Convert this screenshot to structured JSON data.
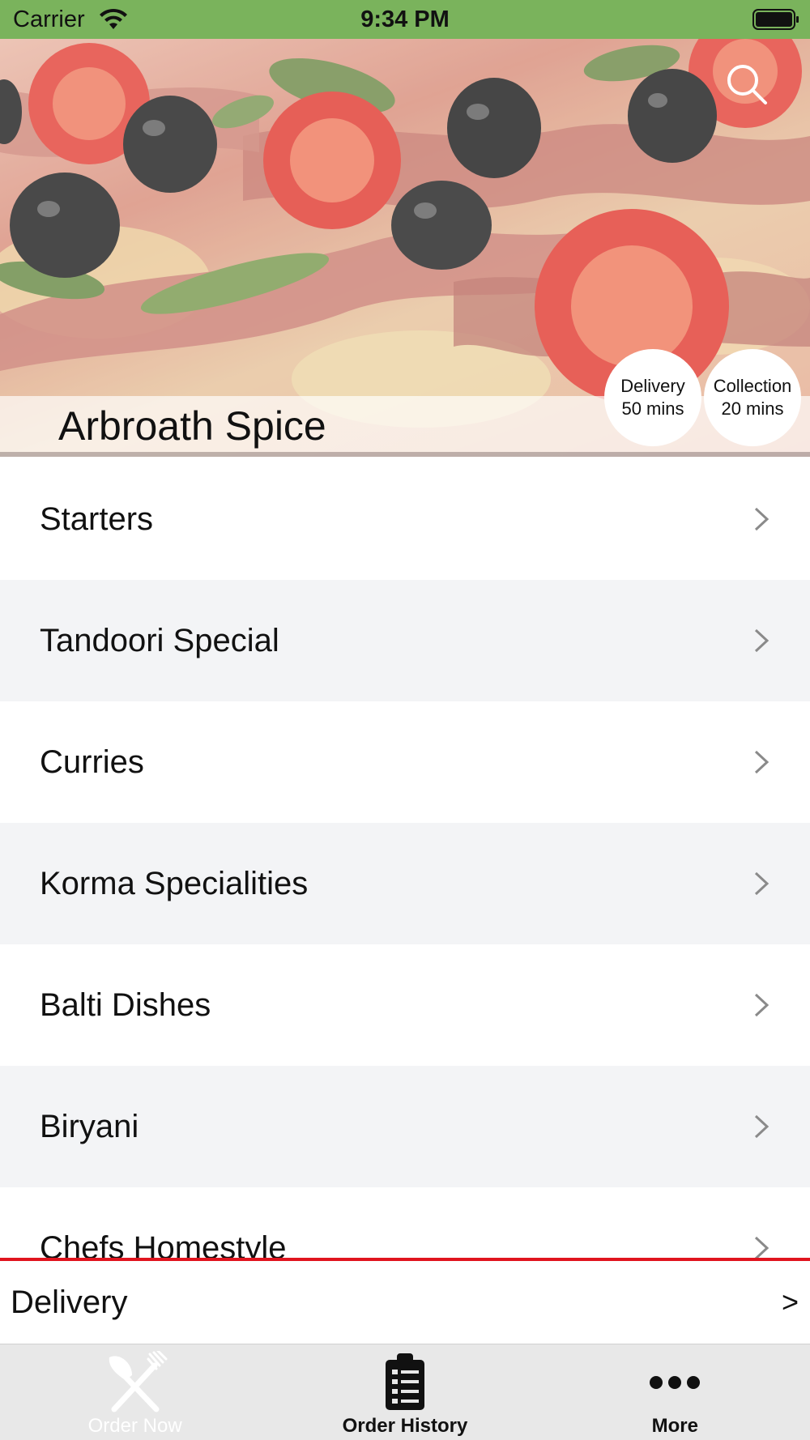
{
  "status_bar": {
    "carrier": "Carrier",
    "time": "9:34 PM",
    "wifi_icon": "wifi-icon",
    "battery_icon": "battery-icon",
    "background_color": "#7ab35c"
  },
  "hero": {
    "restaurant_name": "Arbroath Spice",
    "search_icon": "search-icon",
    "delivery": {
      "label": "Delivery",
      "time": "50 mins"
    },
    "collection": {
      "label": "Collection",
      "time": "20 mins"
    }
  },
  "menu": {
    "items": [
      {
        "label": "Starters"
      },
      {
        "label": "Tandoori Special"
      },
      {
        "label": "Curries"
      },
      {
        "label": "Korma Specialities"
      },
      {
        "label": "Balti Dishes"
      },
      {
        "label": "Biryani"
      },
      {
        "label": "Chefs Homestyle"
      }
    ],
    "chevron_icon": "chevron-right-icon"
  },
  "delivery_bar": {
    "label": "Delivery",
    "arrow": ">",
    "divider_color": "#e0141e"
  },
  "tab_bar": {
    "tabs": [
      {
        "label": "Order Now",
        "icon": "fork-knife-icon",
        "active": true
      },
      {
        "label": "Order History",
        "icon": "clipboard-list-icon",
        "active": false
      },
      {
        "label": "More",
        "icon": "more-dots-icon",
        "active": false
      }
    ]
  }
}
